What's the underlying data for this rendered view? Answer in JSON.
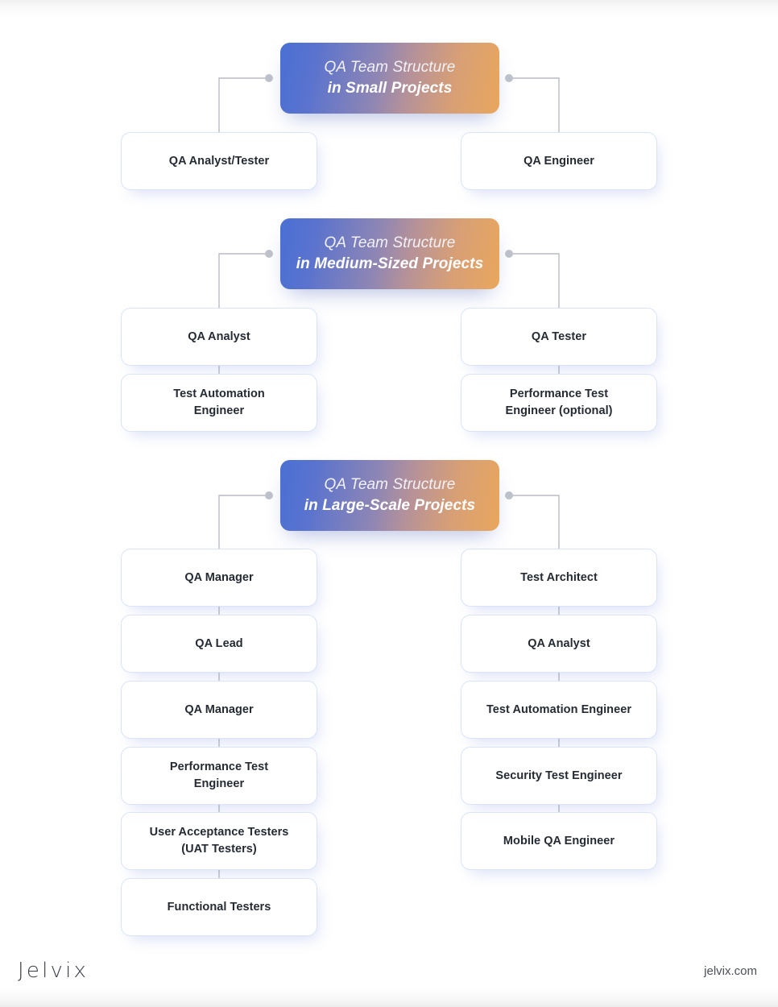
{
  "footer": {
    "logo": "Jelvix",
    "url": "jelvix.com"
  },
  "colors": {
    "gradient_start": "#4a6fd4",
    "gradient_mid": "#9a8fa8",
    "gradient_end": "#e9a75d",
    "card_border": "#dbe3fb",
    "card_text": "#252a33",
    "wire": "#b8bcc4"
  },
  "chart_data": {
    "type": "diagram",
    "title": "QA Team Structure",
    "sections": [
      {
        "id": "small",
        "header_line1": "QA Team Structure",
        "header_line2": "in Small Projects",
        "left_column": [
          "QA Analyst/Tester"
        ],
        "right_column": [
          "QA Engineer"
        ]
      },
      {
        "id": "medium",
        "header_line1": "QA Team Structure",
        "header_line2": "in Medium-Sized Projects",
        "left_column": [
          "QA Analyst",
          "Test Automation Engineer"
        ],
        "right_column": [
          "QA Tester",
          "Performance Test Engineer (optional)"
        ]
      },
      {
        "id": "large",
        "header_line1": "QA Team Structure",
        "header_line2": "in Large-Scale Projects",
        "left_column": [
          "QA Manager",
          "QA Lead",
          "QA Manager",
          "Performance Test Engineer",
          "User Acceptance Testers (UAT Testers)",
          "Functional Testers"
        ],
        "right_column": [
          "Test Architect",
          "QA Analyst",
          "Test Automation Engineer",
          "Security Test Engineer",
          "Mobile QA Engineer"
        ]
      }
    ]
  },
  "sections": [
    {
      "header": {
        "line1": "QA Team Structure",
        "line2": "in Small Projects"
      },
      "left": [
        {
          "label": "QA Analyst/Tester"
        }
      ],
      "right": [
        {
          "label": "QA Engineer"
        }
      ]
    },
    {
      "header": {
        "line1": "QA Team Structure",
        "line2": "in Medium-Sized Projects"
      },
      "left": [
        {
          "label": "QA Analyst"
        },
        {
          "label": "Test Automation\nEngineer"
        }
      ],
      "right": [
        {
          "label": "QA Tester"
        },
        {
          "label": "Performance Test\nEngineer (optional)"
        }
      ]
    },
    {
      "header": {
        "line1": "QA Team Structure",
        "line2": "in Large-Scale Projects"
      },
      "left": [
        {
          "label": "QA Manager"
        },
        {
          "label": "QA Lead"
        },
        {
          "label": "QA Manager"
        },
        {
          "label": "Performance Test\nEngineer"
        },
        {
          "label": "User Acceptance Testers\n(UAT Testers)"
        },
        {
          "label": "Functional Testers"
        }
      ],
      "right": [
        {
          "label": "Test Architect"
        },
        {
          "label": "QA Analyst"
        },
        {
          "label": "Test Automation Engineer"
        },
        {
          "label": "Security Test Engineer"
        },
        {
          "label": "Mobile QA Engineer"
        }
      ]
    }
  ]
}
